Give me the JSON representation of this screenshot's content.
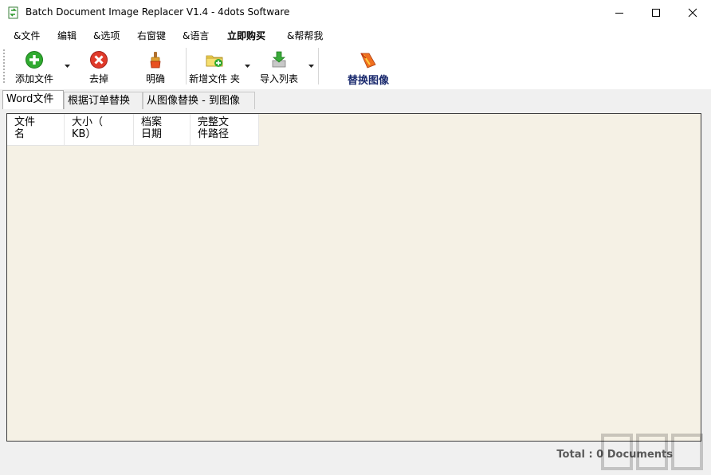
{
  "window": {
    "title": "Batch Document Image Replacer V1.4 - 4dots Software"
  },
  "menu": {
    "items": [
      "&文件",
      "编辑",
      "&选项",
      "右窗键",
      "&语言",
      "立即购买",
      "&帮帮我"
    ]
  },
  "toolbar": {
    "add_file": "添加文件",
    "remove": "去掉",
    "clear": "明确",
    "add_folder": "新增文件 夹",
    "import_list": "导入列表",
    "replace_images": "替换图像"
  },
  "tabs": [
    "Word文件",
    "根据订单替换",
    "从图像替换 - 到图像"
  ],
  "list": {
    "columns": [
      "文件\n名",
      "大小（\nKB）",
      "档案\n日期",
      "完整文\n件路径"
    ]
  },
  "status": {
    "total": "Total : 0 Documents"
  }
}
